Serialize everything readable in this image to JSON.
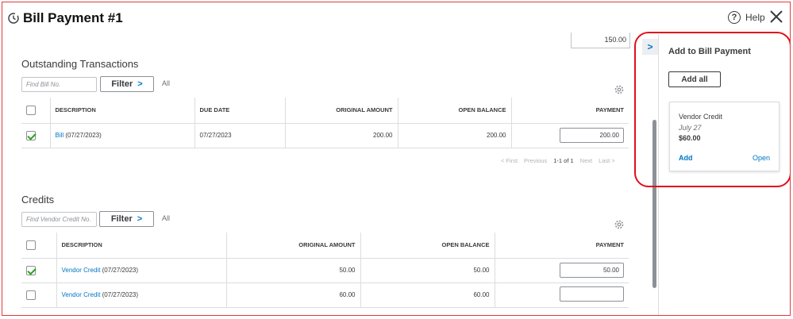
{
  "header": {
    "title": "Bill Payment #1",
    "help_label": "Help",
    "help_glyph": "?"
  },
  "amount_top": "150.00",
  "outstanding": {
    "title": "Outstanding Transactions",
    "find_placeholder": "Find Bill No.",
    "filter_label": "Filter",
    "filter_chevron": ">",
    "all_label": "All",
    "columns": [
      "DESCRIPTION",
      "DUE DATE",
      "ORIGINAL AMOUNT",
      "OPEN BALANCE",
      "PAYMENT"
    ],
    "rows": [
      {
        "checked": true,
        "desc_link": "Bill",
        "desc_rest": " (07/27/2023)",
        "due_date": "07/27/2023",
        "original": "200.00",
        "open": "200.00",
        "payment": "200.00"
      }
    ],
    "pager": {
      "first": "< First",
      "previous": "Previous",
      "range": "1-1 of 1",
      "next": "Next",
      "last": "Last >"
    }
  },
  "credits": {
    "title": "Credits",
    "find_placeholder": "Find Vendor Credit No.",
    "filter_label": "Filter",
    "filter_chevron": ">",
    "all_label": "All",
    "columns": [
      "DESCRIPTION",
      "ORIGINAL AMOUNT",
      "OPEN BALANCE",
      "PAYMENT"
    ],
    "rows": [
      {
        "checked": true,
        "desc_link": "Vendor Credit",
        "desc_rest": " (07/27/2023)",
        "original": "50.00",
        "open": "50.00",
        "payment": "50.00"
      },
      {
        "checked": false,
        "desc_link": "Vendor Credit",
        "desc_rest": " (07/27/2023)",
        "original": "60.00",
        "open": "60.00",
        "payment": ""
      }
    ]
  },
  "panel": {
    "toggle_glyph": ">",
    "title": "Add to Bill Payment",
    "add_all_label": "Add all",
    "card": {
      "title": "Vendor Credit",
      "date": "July 27",
      "amount": "$60.00",
      "add_label": "Add",
      "open_label": "Open"
    }
  },
  "colors": {
    "link": "#0077c5",
    "check": "#2ca01c",
    "annotation": "#e0101a"
  }
}
